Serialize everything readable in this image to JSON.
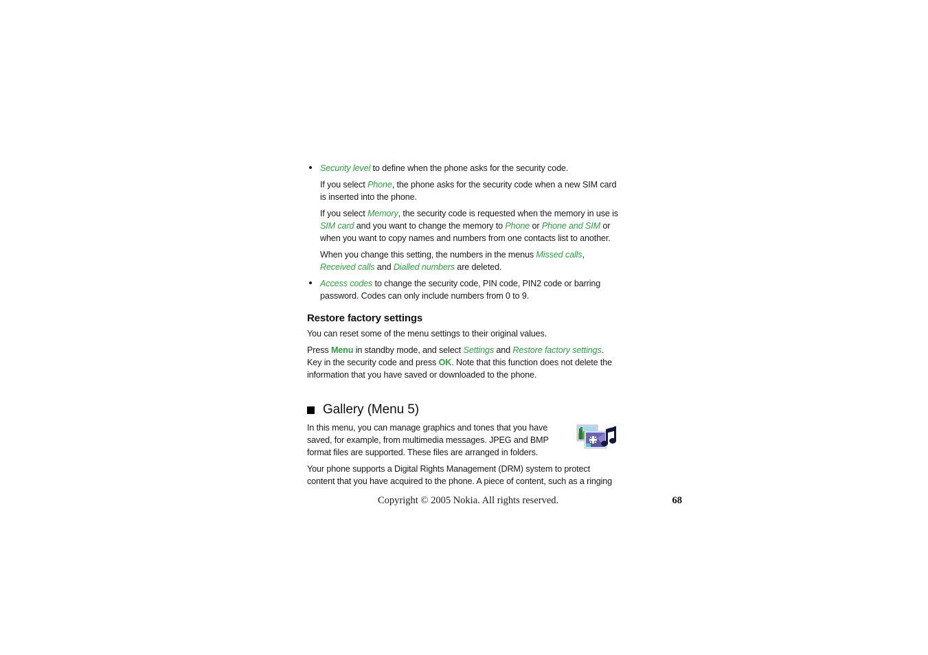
{
  "document": {
    "bullets": [
      {
        "id": "security-level",
        "paragraphs": [
          {
            "runs": [
              {
                "text": "Security level",
                "style": "green-italic"
              },
              {
                "text": " to define when the phone asks for the security code.",
                "style": "plain"
              }
            ]
          },
          {
            "runs": [
              {
                "text": "If you select ",
                "style": "plain"
              },
              {
                "text": "Phone",
                "style": "green-italic"
              },
              {
                "text": ", the phone asks for the security code when a new SIM card is inserted into the phone.",
                "style": "plain"
              }
            ]
          },
          {
            "runs": [
              {
                "text": "If you select ",
                "style": "plain"
              },
              {
                "text": "Memory",
                "style": "green-italic"
              },
              {
                "text": ", the security code is requested when the memory in use is ",
                "style": "plain"
              },
              {
                "text": "SIM card",
                "style": "green-italic"
              },
              {
                "text": " and you want to change the memory to ",
                "style": "plain"
              },
              {
                "text": "Phone",
                "style": "green-italic"
              },
              {
                "text": " or ",
                "style": "plain"
              },
              {
                "text": "Phone and SIM",
                "style": "green-italic"
              },
              {
                "text": " or when you want to copy names and numbers from one contacts list to another.",
                "style": "plain"
              }
            ]
          },
          {
            "runs": [
              {
                "text": "When you change this setting, the numbers in the menus ",
                "style": "plain"
              },
              {
                "text": "Missed calls",
                "style": "green-italic"
              },
              {
                "text": ", ",
                "style": "plain"
              },
              {
                "text": "Received calls",
                "style": "green-italic"
              },
              {
                "text": " and ",
                "style": "plain"
              },
              {
                "text": "Dialled numbers",
                "style": "green-italic"
              },
              {
                "text": " are deleted.",
                "style": "plain"
              }
            ]
          }
        ]
      },
      {
        "id": "access-codes",
        "paragraphs": [
          {
            "runs": [
              {
                "text": "Access codes",
                "style": "green-italic"
              },
              {
                "text": " to change the security code, PIN code, PIN2 code or barring password. Codes can only include numbers from 0 to 9.",
                "style": "plain"
              }
            ]
          }
        ]
      }
    ],
    "restore_section": {
      "heading": "Restore factory settings",
      "paragraphs": [
        {
          "runs": [
            {
              "text": "You can reset some of the menu settings to their original values.",
              "style": "plain"
            }
          ]
        },
        {
          "runs": [
            {
              "text": "Press ",
              "style": "plain"
            },
            {
              "text": "Menu",
              "style": "green-bold"
            },
            {
              "text": " in standby mode, and select ",
              "style": "plain"
            },
            {
              "text": "Settings",
              "style": "green-italic"
            },
            {
              "text": " and ",
              "style": "plain"
            },
            {
              "text": "Restore factory settings",
              "style": "green-italic"
            },
            {
              "text": ". Key in the security code and press ",
              "style": "plain"
            },
            {
              "text": "OK",
              "style": "green-bold"
            },
            {
              "text": ". Note that this function does not delete the information that you have saved or downloaded to the phone.",
              "style": "plain"
            }
          ]
        }
      ]
    },
    "gallery_section": {
      "heading": "Gallery (Menu 5)",
      "icon_name": "gallery-icon",
      "paragraphs": [
        {
          "runs": [
            {
              "text": "In this menu, you can manage graphics and tones that you have saved, for example, from multimedia messages. JPEG and BMP format files are supported. These files are arranged in folders.",
              "style": "plain"
            }
          ]
        },
        {
          "runs": [
            {
              "text": "Your phone supports a Digital Rights Management (DRM) system to protect content that you have acquired to the phone. A piece of content, such as a ringing",
              "style": "plain"
            }
          ]
        }
      ]
    },
    "footer": {
      "copyright": "Copyright © 2005 Nokia. All rights reserved.",
      "page_number": "68"
    },
    "colors": {
      "accent_green": "#2f9e41",
      "body_text": "#171717",
      "background": "#ffffff"
    }
  }
}
